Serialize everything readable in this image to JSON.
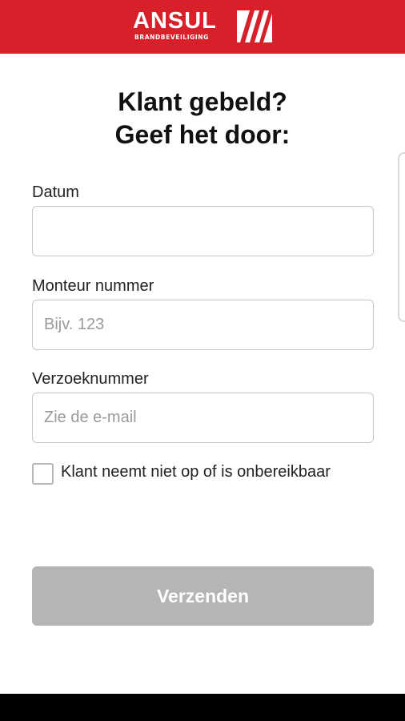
{
  "header": {
    "brand": "ANSUL",
    "brand_sub": "BRANDBEVEILIGING",
    "brand_color": "#d8202a",
    "logo_icon": "ansul-stripes-icon"
  },
  "form": {
    "title_line1": "Klant gebeld?",
    "title_line2": "Geef het door:",
    "datum_label": "Datum",
    "datum_value": "",
    "monteur_label": "Monteur nummer",
    "monteur_placeholder": "Bijv. 123",
    "verzoek_label": "Verzoeknummer",
    "verzoek_placeholder": "Zie de e-mail",
    "checkbox_label": "Klant neemt niet op of is onbereikbaar",
    "checkbox_checked": false,
    "submit_label": "Verzenden",
    "submit_color": "#b5b5b5"
  }
}
